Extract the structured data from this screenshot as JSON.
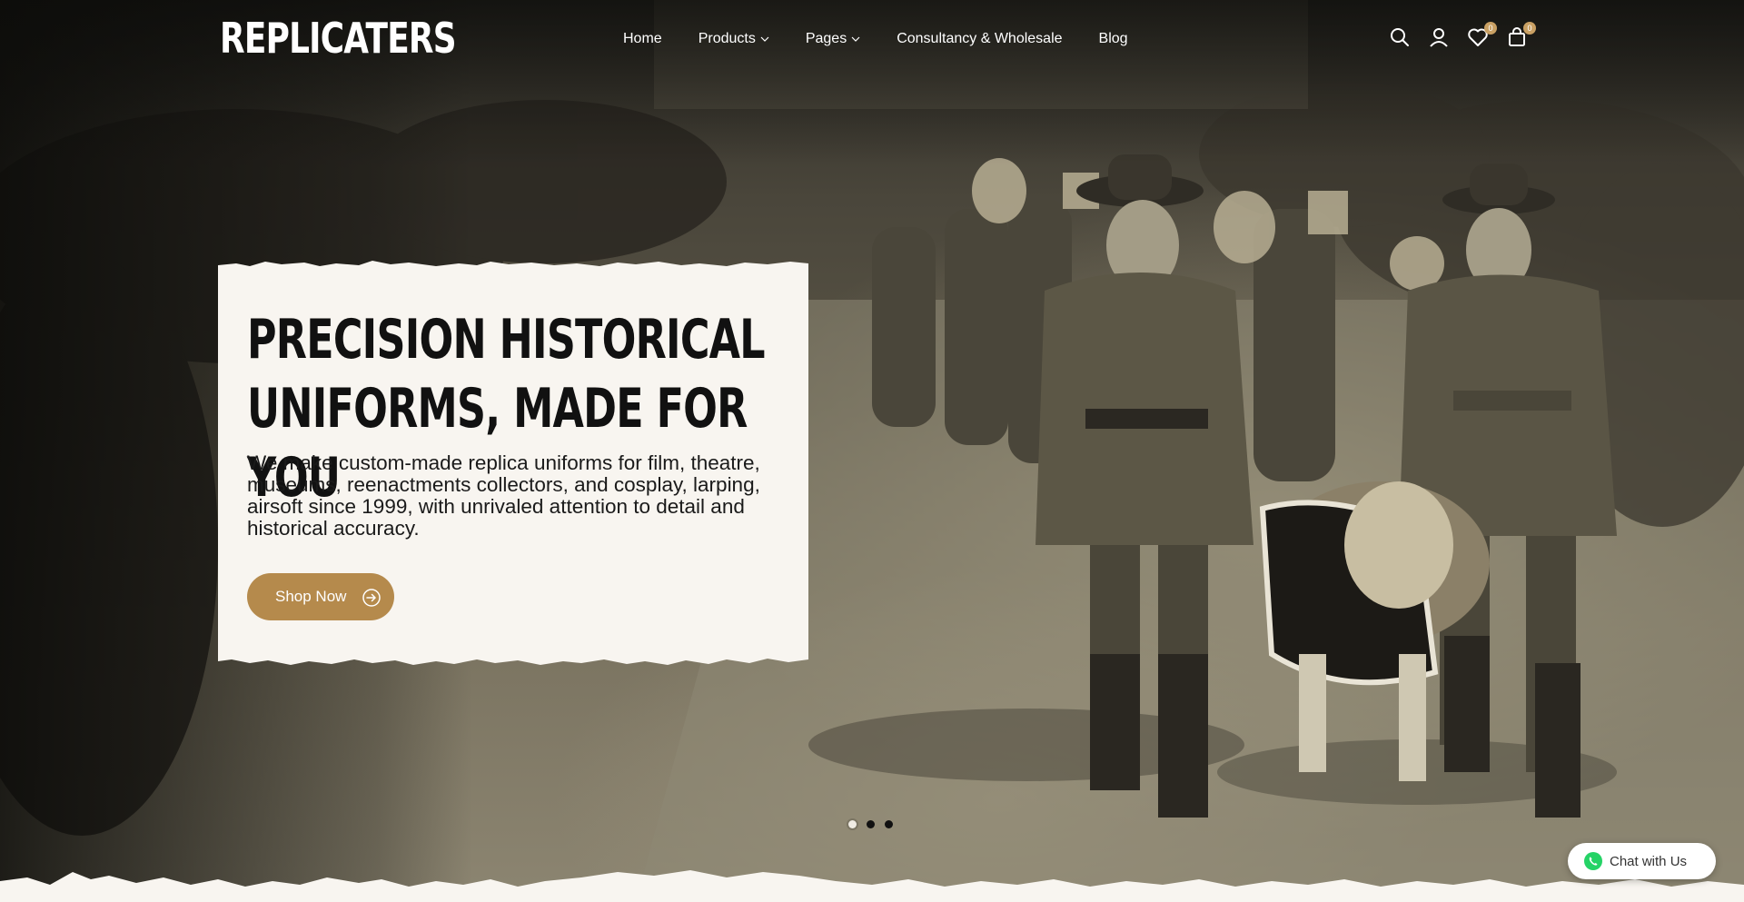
{
  "header": {
    "logo_text": "REPLICATERS",
    "nav": [
      {
        "label": "Home",
        "has_dropdown": false
      },
      {
        "label": "Products",
        "has_dropdown": true
      },
      {
        "label": "Pages",
        "has_dropdown": true
      },
      {
        "label": "Consultancy & Wholesale",
        "has_dropdown": false
      },
      {
        "label": "Blog",
        "has_dropdown": false
      }
    ],
    "icons": {
      "search": "search-icon",
      "account": "user-icon",
      "wishlist": "heart-icon",
      "cart": "bag-icon"
    },
    "wishlist_count": "0",
    "cart_count": "0"
  },
  "hero": {
    "headline_line1": "PRECISION HISTORICAL",
    "headline_line2": "UNIFORMS, MADE FOR YOU",
    "subtext": "We make custom-made replica uniforms for film, theatre, museums, reenactments collectors, and cosplay, larping, airsoft since 1999, with unrivaled attention to detail and historical accuracy.",
    "cta_label": "Shop Now",
    "slides_total": 3,
    "active_slide": 1
  },
  "chat": {
    "label": "Chat with Us",
    "icon": "whatsapp-icon"
  },
  "colors": {
    "accent": "#b58a4c",
    "badge": "#c9a063",
    "card_bg": "#f8f5f0",
    "text_dark": "#111111"
  }
}
